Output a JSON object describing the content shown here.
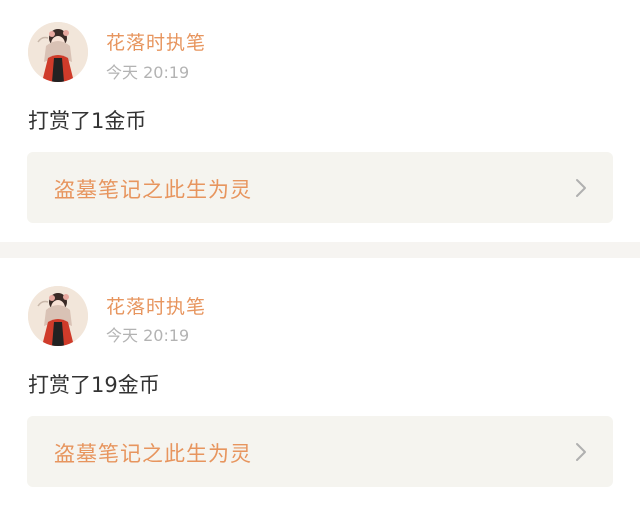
{
  "feed": {
    "items": [
      {
        "user": {
          "name": "花落时执笔",
          "avatar_icon": "avatar-portrait-icon"
        },
        "time": "今天 20:19",
        "message": "打赏了1金币",
        "book": {
          "title": "盗墓笔记之此生为灵",
          "icon": "chevron-right-icon"
        }
      },
      {
        "user": {
          "name": "花落时执笔",
          "avatar_icon": "avatar-portrait-icon"
        },
        "time": "今天 20:19",
        "message": "打赏了19金币",
        "book": {
          "title": "盗墓笔记之此生为灵",
          "icon": "chevron-right-icon"
        }
      }
    ]
  },
  "colors": {
    "accent": "#e7955e",
    "text": "#333333",
    "muted": "#b3b3b3",
    "card_bg": "#f5f4ef",
    "separator": "#f6f4f1"
  }
}
